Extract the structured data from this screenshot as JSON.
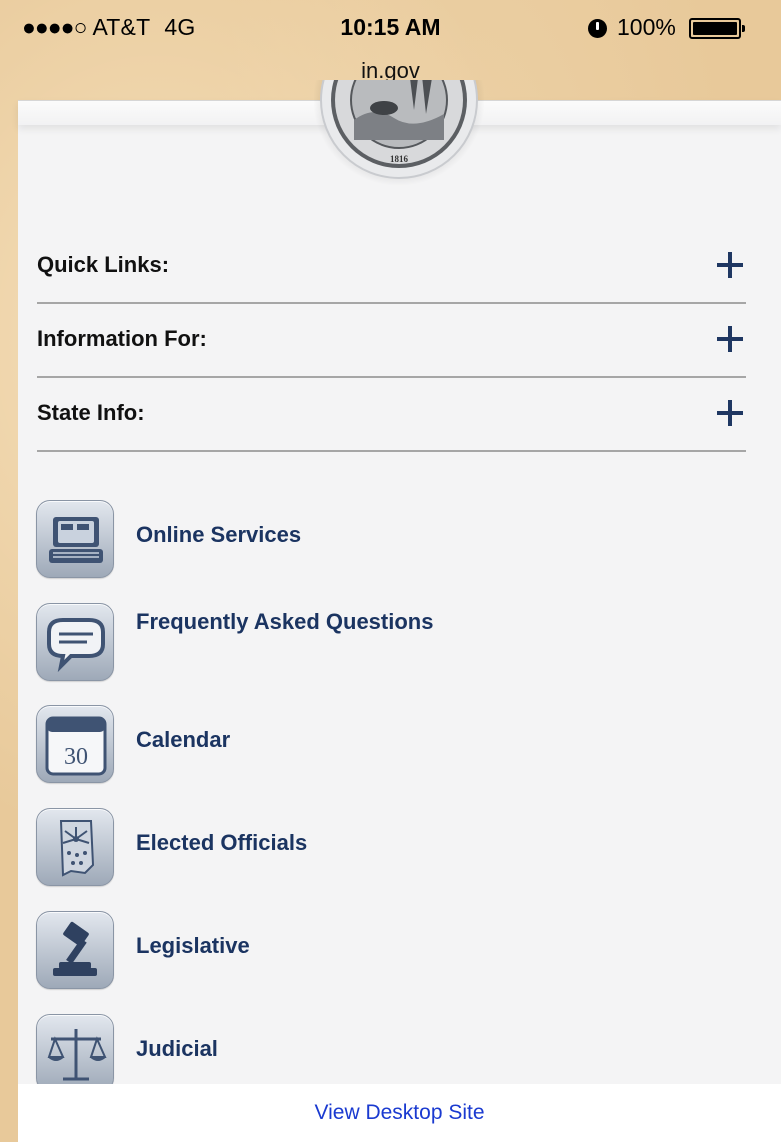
{
  "status_bar": {
    "signal": "●●●●○",
    "carrier": "AT&T",
    "network": "4G",
    "time": "10:15 AM",
    "battery": "100%",
    "alarm_icon": "alarm-clock-icon"
  },
  "browser": {
    "url": "in.gov"
  },
  "header": {
    "seal_icon": "state-seal-icon"
  },
  "accordion": {
    "items": [
      {
        "label": "Quick Links:",
        "icon": "plus-icon"
      },
      {
        "label": "Information For:",
        "icon": "plus-icon"
      },
      {
        "label": "State Info:",
        "icon": "plus-icon"
      }
    ]
  },
  "services": {
    "items": [
      {
        "label": "Online Services",
        "icon": "computer-icon"
      },
      {
        "label": "Frequently Asked Questions",
        "icon": "speech-bubble-icon"
      },
      {
        "label": "Calendar",
        "icon": "calendar-icon",
        "icon_text": "30"
      },
      {
        "label": "Elected Officials",
        "icon": "indiana-map-icon"
      },
      {
        "label": "Legislative",
        "icon": "gavel-icon"
      },
      {
        "label": "Judicial",
        "icon": "scales-icon"
      }
    ]
  },
  "footer": {
    "desktop_link": "View Desktop Site"
  },
  "colors": {
    "accent_navy": "#1b3461",
    "link_blue": "#1a3ad0",
    "page_bg": "#f4f4f5"
  }
}
